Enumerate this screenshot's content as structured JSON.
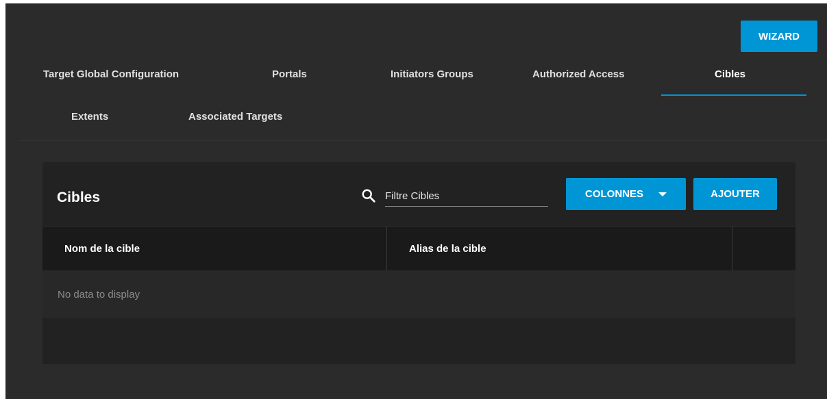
{
  "header": {
    "wizard_label": "WIZARD"
  },
  "tabs": [
    {
      "label": "Target Global Configuration",
      "active": false
    },
    {
      "label": "Portals",
      "active": false
    },
    {
      "label": "Initiators Groups",
      "active": false
    },
    {
      "label": "Authorized Access",
      "active": false
    },
    {
      "label": "Cibles",
      "active": true
    },
    {
      "label": "Extents",
      "active": false
    },
    {
      "label": "Associated Targets",
      "active": false
    }
  ],
  "card": {
    "title": "Cibles",
    "search": {
      "icon": "search-icon",
      "placeholder": "Filtre Cibles",
      "value": ""
    },
    "columns_button_label": "COLONNES",
    "add_button_label": "AJOUTER",
    "table": {
      "columns": [
        "Nom de la cible",
        "Alias de la cible",
        ""
      ],
      "rows": [],
      "empty_message": "No data to display"
    }
  },
  "colors": {
    "accent": "#0095d5",
    "background": "#2b2b2b",
    "card": "#222222",
    "table_header": "#1a1a1a"
  }
}
